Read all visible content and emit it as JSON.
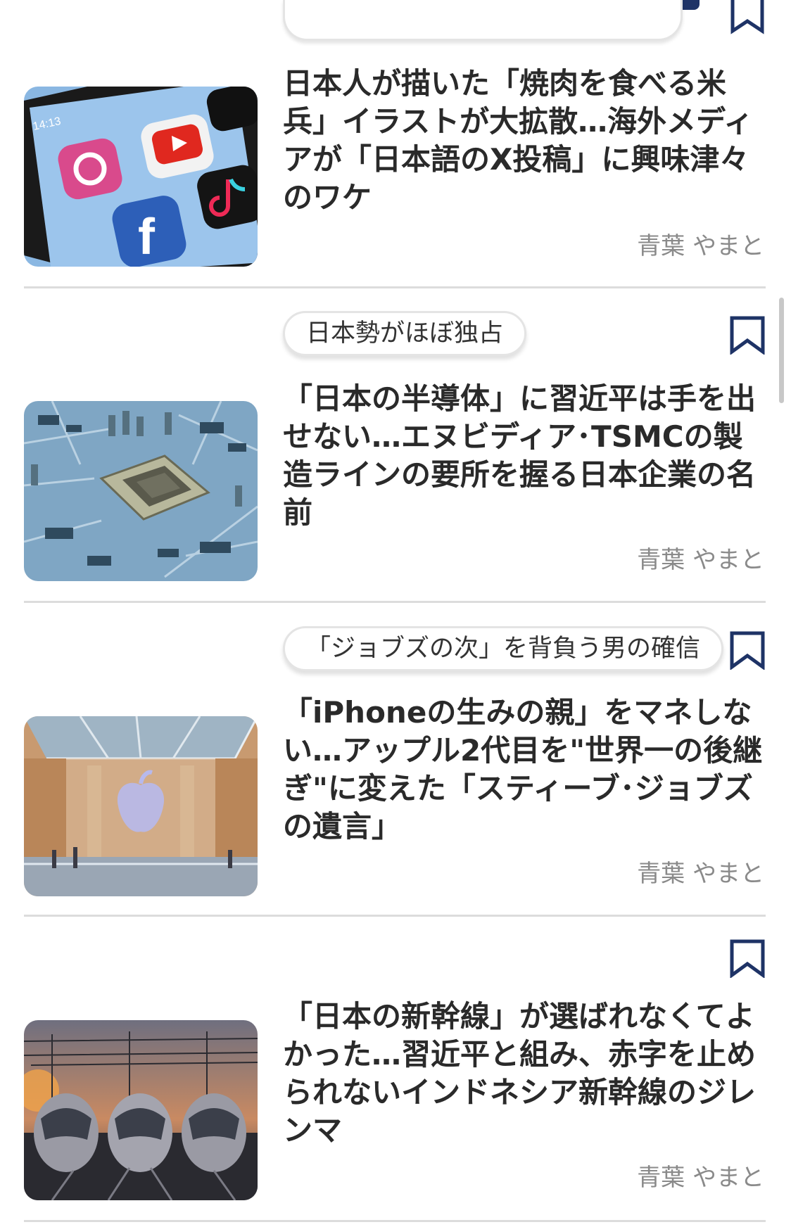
{
  "articles": [
    {
      "tag": "",
      "headline": "日本人が描いた「焼肉を食べる米兵」イラストが大拡散…海外メディアが「日本語のX投稿」に興味津々のワケ",
      "author": "青葉 やまと",
      "image": "smartphone-social-apps-icon-screen"
    },
    {
      "tag": "日本勢がほぼ独占",
      "headline": "「日本の半導体」に習近平は手を出せない…エヌビディア･TSMCの製造ラインの要所を握る日本企業の名前",
      "author": "青葉 やまと",
      "image": "semiconductor-chip-circuit-board"
    },
    {
      "tag": "「ジョブズの次」を背負う男の確信",
      "headline": "「iPhoneの生みの親」をマネしない…アップル2代目を\"世界一の後継ぎ\"に変えた「スティーブ･ジョブズの遺言」",
      "author": "青葉 やまと",
      "image": "apple-store-glass-logo"
    },
    {
      "tag": "",
      "headline": "「日本の新幹線」が選ばれなくてよかった…習近平と組み、赤字を止められないインドネシア新幹線のジレンマ",
      "author": "青葉 やまと",
      "image": "high-speed-trains-sunset"
    }
  ],
  "colors": {
    "accent_navy": "#1e3366",
    "headline_text": "#2a2a2a",
    "author_text": "#8a8a8a",
    "divider": "#dcdcdc"
  }
}
